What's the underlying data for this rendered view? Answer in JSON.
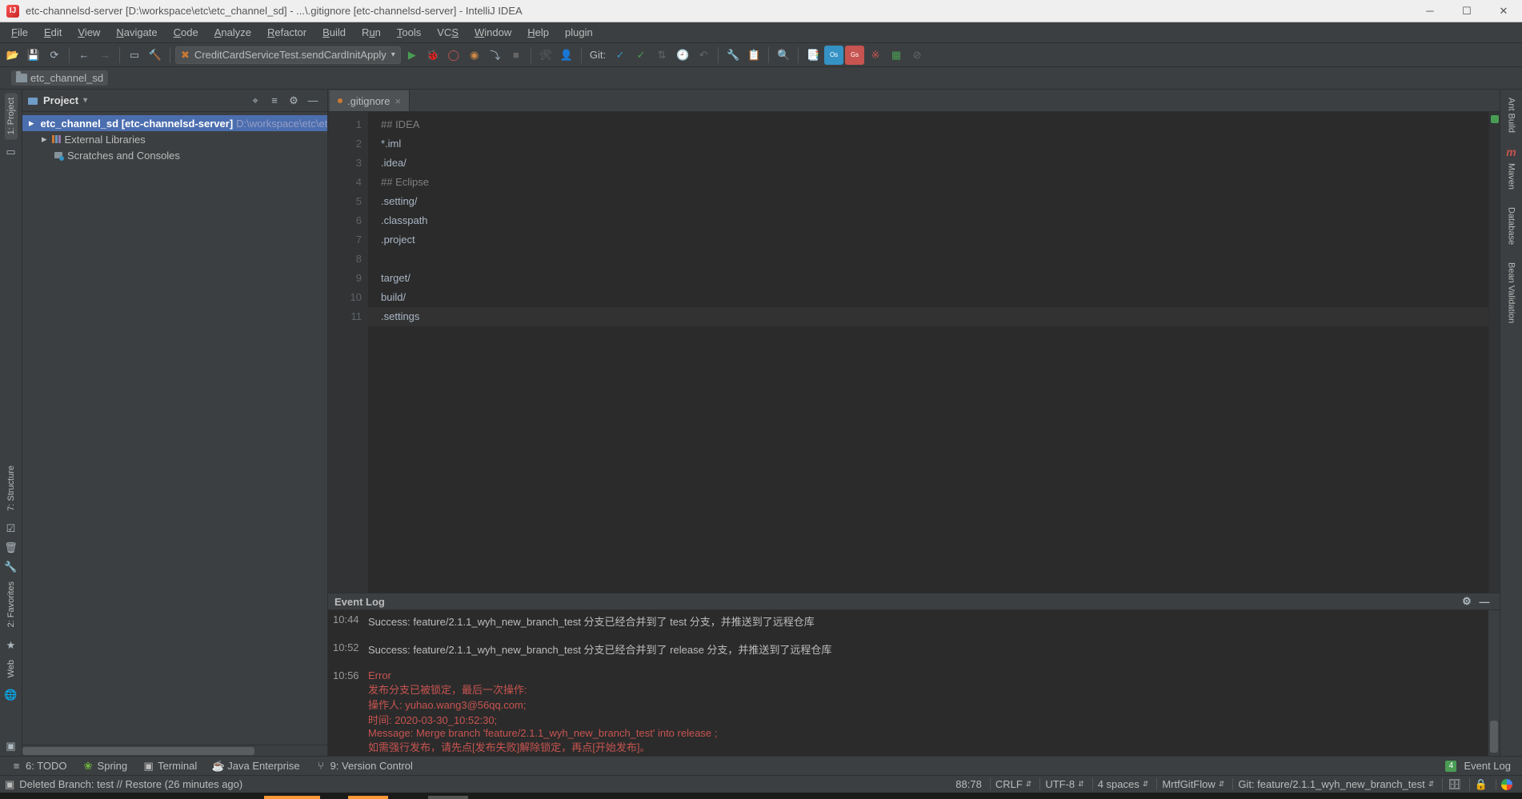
{
  "titlebar": {
    "text": "etc-channelsd-server [D:\\workspace\\etc\\etc_channel_sd] - ...\\.gitignore [etc-channelsd-server] - IntelliJ IDEA"
  },
  "menu": {
    "items": [
      "File",
      "Edit",
      "View",
      "Navigate",
      "Code",
      "Analyze",
      "Refactor",
      "Build",
      "Run",
      "Tools",
      "VCS",
      "Window",
      "Help",
      "plugin"
    ]
  },
  "menu_ul": [
    0,
    0,
    0,
    0,
    0,
    0,
    0,
    0,
    0,
    0,
    2,
    0,
    0,
    -1
  ],
  "toolbar": {
    "runconfig_label": "CreditCardServiceTest.sendCardInitApply",
    "git_label": "Git:"
  },
  "nav_crumb": "etc_channel_sd",
  "project_panel": {
    "title": "Project",
    "tree": {
      "root_name": "etc_channel_sd",
      "root_module": "[etc-channelsd-server]",
      "root_path": "D:\\workspace\\etc\\etc_channel_sd",
      "nodes": [
        "External Libraries",
        "Scratches and Consoles"
      ]
    }
  },
  "left_sidetabs": [
    "1: Project",
    "7: Structure"
  ],
  "left_sidetabs_bottom": [
    "2: Favorites",
    "Web"
  ],
  "right_sidetabs": [
    "Ant Build",
    "Maven",
    "Database",
    "Bean Validation"
  ],
  "editor": {
    "tab": ".gitignore",
    "lines": [
      "## IDEA",
      "*.iml",
      ".idea/",
      "## Eclipse",
      ".setting/",
      ".classpath",
      ".project",
      "",
      "target/",
      "build/",
      ".settings"
    ],
    "current_line": 11
  },
  "eventlog": {
    "title": "Event Log",
    "entries": [
      {
        "time": "10:44",
        "type": "success",
        "lines": [
          "Success: feature/2.1.1_wyh_new_branch_test 分支已经合并到了 test 分支，并推送到了远程仓库"
        ]
      },
      {
        "time": "10:52",
        "type": "success",
        "lines": [
          "Success: feature/2.1.1_wyh_new_branch_test 分支已经合并到了 release 分支，并推送到了远程仓库"
        ]
      },
      {
        "time": "10:56",
        "type": "error",
        "lines": [
          "Error",
          "发布分支已被锁定，最后一次操作:",
          "操作人: yuhao.wang3@56qq.com;",
          "时间: 2020-03-30_10:52:30;",
          "Message: Merge branch 'feature/2.1.1_wyh_new_branch_test' into release ;",
          "如需强行发布，请先点[发布失败]解除锁定，再点[开始发布]。"
        ]
      }
    ]
  },
  "bottom_tabs": [
    "6: TODO",
    "Spring",
    "Terminal",
    "Java Enterprise",
    "9: Version Control"
  ],
  "bottom_right": {
    "eventlog": "Event Log",
    "badge": "4"
  },
  "status": {
    "left": "Deleted Branch: test // Restore (26 minutes ago)",
    "caret": "88:78",
    "line_sep": "CRLF",
    "encoding": "UTF-8",
    "indent": "4 spaces",
    "mgf": "MrtfGitFlow",
    "git": "Git: feature/2.1.1_wyh_new_branch_test"
  }
}
